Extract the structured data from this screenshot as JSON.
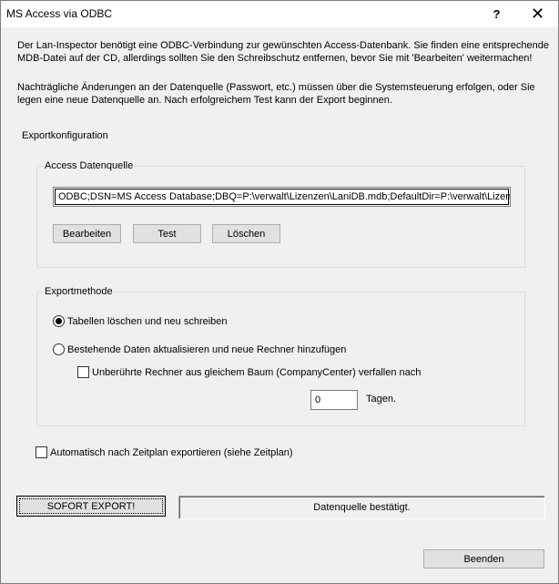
{
  "window": {
    "title": "MS Access via ODBC",
    "help_glyph": "?",
    "close_glyph": "✕"
  },
  "intro": {
    "para1": "Der Lan-Inspector benötigt eine ODBC-Verbindung zur gewünschten Access-Datenbank. Sie finden eine entsprechende MDB-Datei auf der CD, allerdings sollten Sie den Schreibschutz entfernen, bevor Sie mit 'Bearbeiten' weitermachen!",
    "para2": "Nachträgliche Änderungen an der Datenquelle (Passwort, etc.) müssen über die Systemsteuerung erfolgen, oder Sie legen eine neue Datenquelle an. Nach erfolgreichem Test kann der Export beginnen."
  },
  "export_config": {
    "label": "Exportkonfiguration",
    "access_source": {
      "label": "Access Datenquelle",
      "dsn_value": "ODBC;DSN=MS Access Database;DBQ=P:\\verwalt\\Lizenzen\\LaniDB.mdb;DefaultDir=P:\\verwalt\\Lizenzen",
      "buttons": {
        "edit": "Bearbeiten",
        "test": "Test",
        "delete": "Löschen"
      }
    },
    "method": {
      "label": "Exportmethode",
      "option_rewrite": "Tabellen löschen und neu schreiben",
      "option_update": "Bestehende Daten aktualisieren und neue Rechner hinzufügen",
      "selected": "rewrite",
      "expire_checkbox": "Unberührte Rechner aus gleichem Baum (CompanyCenter) verfallen nach",
      "expire_checked": false,
      "days_value": "0",
      "days_label": "Tagen."
    },
    "schedule_checkbox": "Automatisch nach Zeitplan exportieren (siehe Zeitplan)",
    "schedule_checked": false
  },
  "actions": {
    "export_now": "SOFORT EXPORT!",
    "status": "Datenquelle bestätigt.",
    "close": "Beenden"
  }
}
